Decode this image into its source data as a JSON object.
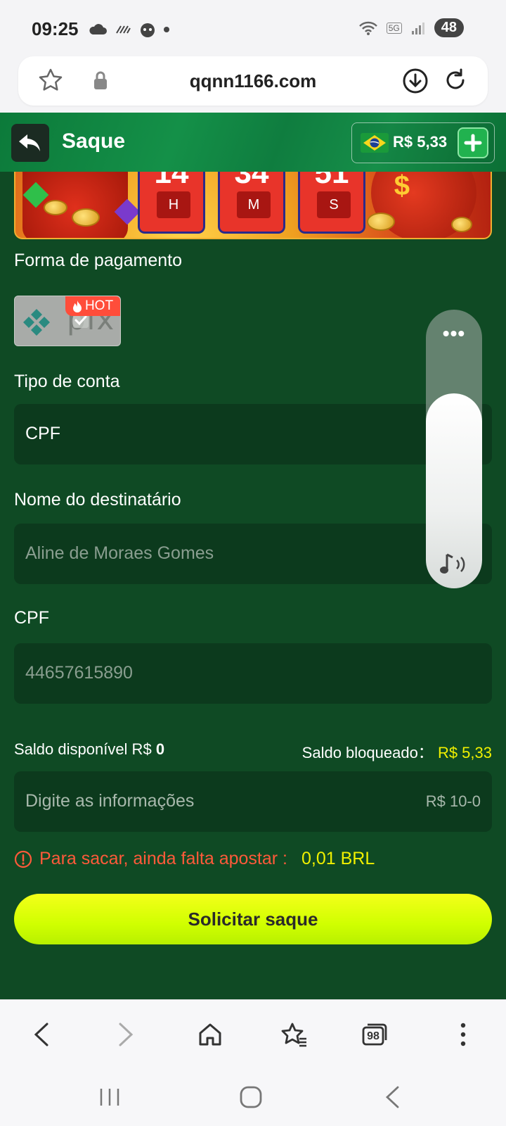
{
  "status_bar": {
    "time": "09:25",
    "network": "5G",
    "battery": "48"
  },
  "browser": {
    "url": "qqnn1166.com",
    "tabs_count": "98"
  },
  "header": {
    "title": "Saque",
    "balance": "R$ 5,33"
  },
  "banner": {
    "timers": [
      {
        "value": "14",
        "unit": "H"
      },
      {
        "value": "34",
        "unit": "M"
      },
      {
        "value": "51",
        "unit": "S"
      }
    ]
  },
  "form": {
    "payment_label": "Forma de pagamento",
    "payment_method": {
      "name": "PIX",
      "badge": "HOT"
    },
    "account_type_label": "Tipo de conta",
    "account_type_value": "CPF",
    "recipient_label": "Nome do destinatário",
    "recipient_value": "Aline de Moraes Gomes",
    "cpf_label": "CPF",
    "cpf_value": "44657615890",
    "saldo_disponivel_label": "Saldo disponível R$",
    "saldo_disponivel_value": "0",
    "saldo_bloqueado_label": "Saldo bloqueado：",
    "saldo_bloqueado_value": "R$ 5,33",
    "amount_placeholder": "Digite as informações",
    "amount_range": "R$ 10-0",
    "warning_text": "Para sacar, ainda falta apostar :",
    "warning_value": "0,01 BRL",
    "submit_label": "Solicitar saque"
  },
  "volume_overlay": {
    "level": 0.7,
    "more": "•••"
  },
  "colors": {
    "header_green": "#149048",
    "content_bg": "#0f4a24",
    "field_bg": "#0c3a1d",
    "accent_yellow": "#f0f000",
    "warning_red": "#ff5a3a",
    "button_lime": "#d0ff00"
  }
}
